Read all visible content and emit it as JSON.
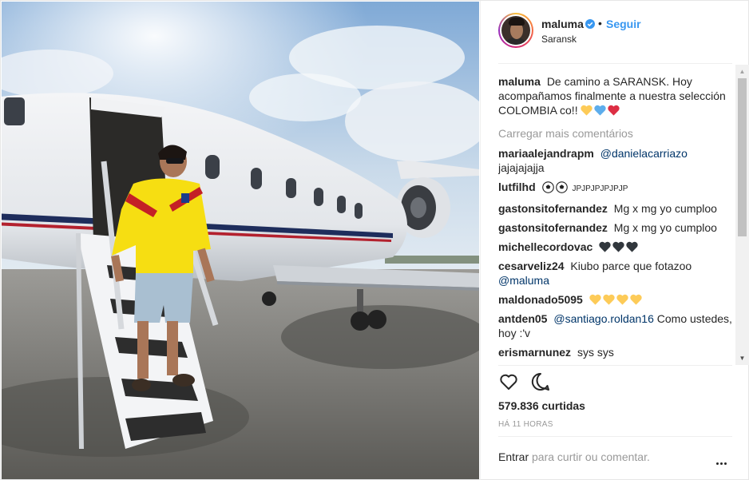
{
  "post": {
    "username": "maluma",
    "follow_label": "Seguir",
    "location": "Saransk",
    "dot": "•"
  },
  "caption": {
    "user": "maluma",
    "text": "De camino a SARANSK. Hoy acompañamos finalmente a nuestra selección COLOMBIA co!!"
  },
  "load_more_label": "Carregar mais comentários",
  "comments": [
    {
      "user": "mariaalejandrapm",
      "mention": "@danielacarriazo",
      "text": "jajajajajja"
    },
    {
      "user": "lutfilhd",
      "text": "JPJPJPJPJPJP"
    },
    {
      "user": "gastonsitofernandez",
      "text": "Mg x mg yo cumploo"
    },
    {
      "user": "gastonsitofernandez",
      "text": "Mg x mg yo cumploo"
    },
    {
      "user": "michellecordovac",
      "text": ""
    },
    {
      "user": "cesarveliz24",
      "text": "Kiubo parce que fotazoo",
      "mention": "@maluma"
    },
    {
      "user": "maldonado5095",
      "text": ""
    },
    {
      "user": "antden05",
      "mention": "@santiago.roldan16",
      "text": "Como ustedes, hoy :'v"
    },
    {
      "user": "erismarnunez",
      "text": "sys sys"
    }
  ],
  "likes": "579.836 curtidas",
  "time_ago": "HÁ 11 HORAS",
  "comment_box": {
    "enter": "Entrar",
    "hint": "para curtir ou comentar."
  },
  "icons": {
    "verified": "verified-badge-icon",
    "like": "heart-outline-icon",
    "comment": "comment-bubble-icon",
    "more": "more-options-icon"
  },
  "colors": {
    "link": "#3897f0",
    "mention": "#003569",
    "muted": "#999999",
    "heart_yellow": "#fdcb58",
    "heart_blue": "#5dadec",
    "heart_red": "#dd2e44",
    "heart_black": "#31373d"
  }
}
